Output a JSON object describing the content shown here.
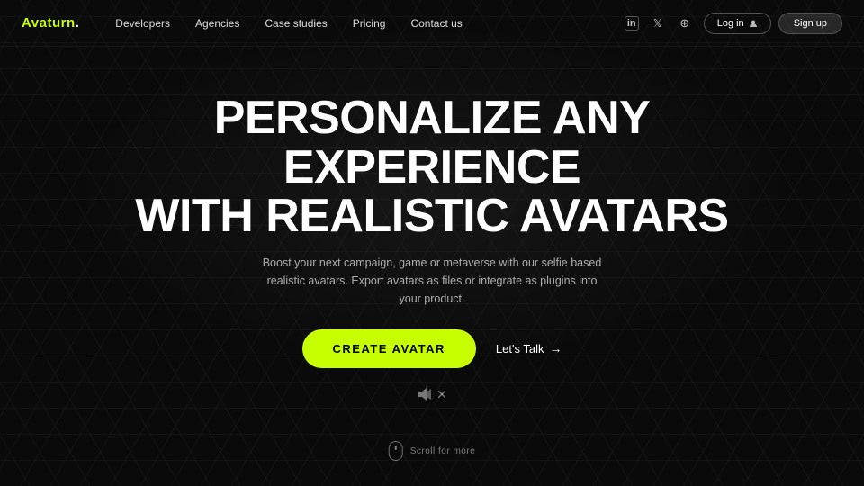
{
  "brand": {
    "name": "Avaturn.",
    "logo_text": "Avaturn",
    "logo_dot": "."
  },
  "nav": {
    "links": [
      {
        "id": "developers",
        "label": "Developers"
      },
      {
        "id": "agencies",
        "label": "Agencies"
      },
      {
        "id": "case-studies",
        "label": "Case studies"
      },
      {
        "id": "pricing",
        "label": "Pricing"
      },
      {
        "id": "contact-us",
        "label": "Contact us"
      }
    ],
    "login_label": "Log in",
    "signup_label": "Sign up",
    "icons": {
      "linkedin": "in",
      "twitter": "𝕏",
      "discord": "⊕"
    }
  },
  "hero": {
    "title_line1": "PERSONALIZE ANY EXPERIENCE",
    "title_line2": "WITH REALISTIC AVATARS",
    "subtitle": "Boost your next campaign, game or metaverse with our selfie based realistic avatars. Export avatars as files or integrate as plugins into your product.",
    "cta_primary": "CREATE AVATAR",
    "cta_secondary": "Let's Talk"
  },
  "scroll": {
    "label": "Scroll for more"
  },
  "colors": {
    "accent": "#c8ff00",
    "bg": "#0a0a0a",
    "text_primary": "#ffffff",
    "text_secondary": "rgba(255,255,255,0.65)"
  }
}
